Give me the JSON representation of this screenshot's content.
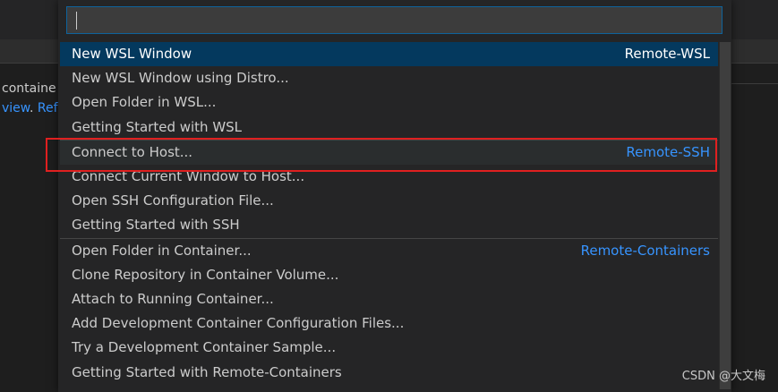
{
  "background": {
    "text_line1": "containe",
    "text_line2_link": "view",
    "text_line2_sep": ".",
    "text_line2_link2": "Ref"
  },
  "palette": {
    "input_value": "",
    "items": [
      {
        "label": "New WSL Window",
        "group": "Remote-WSL",
        "selected": true
      },
      {
        "label": "New WSL Window using Distro...",
        "group": ""
      },
      {
        "label": "Open Folder in WSL...",
        "group": ""
      },
      {
        "label": "Getting Started with WSL",
        "group": ""
      },
      {
        "label": "Connect to Host...",
        "group": "Remote-SSH",
        "separator": true
      },
      {
        "label": "Connect Current Window to Host...",
        "group": ""
      },
      {
        "label": "Open SSH Configuration File...",
        "group": ""
      },
      {
        "label": "Getting Started with SSH",
        "group": ""
      },
      {
        "label": "Open Folder in Container...",
        "group": "Remote-Containers",
        "separator": true
      },
      {
        "label": "Clone Repository in Container Volume...",
        "group": ""
      },
      {
        "label": "Attach to Running Container...",
        "group": ""
      },
      {
        "label": "Add Development Container Configuration Files...",
        "group": ""
      },
      {
        "label": "Try a Development Container Sample...",
        "group": ""
      },
      {
        "label": "Getting Started with Remote-Containers",
        "group": ""
      }
    ]
  },
  "watermark": "CSDN @大文梅",
  "colors": {
    "accent_link": "#3794ff",
    "selection": "#04395e",
    "highlight_box": "#e02020"
  }
}
